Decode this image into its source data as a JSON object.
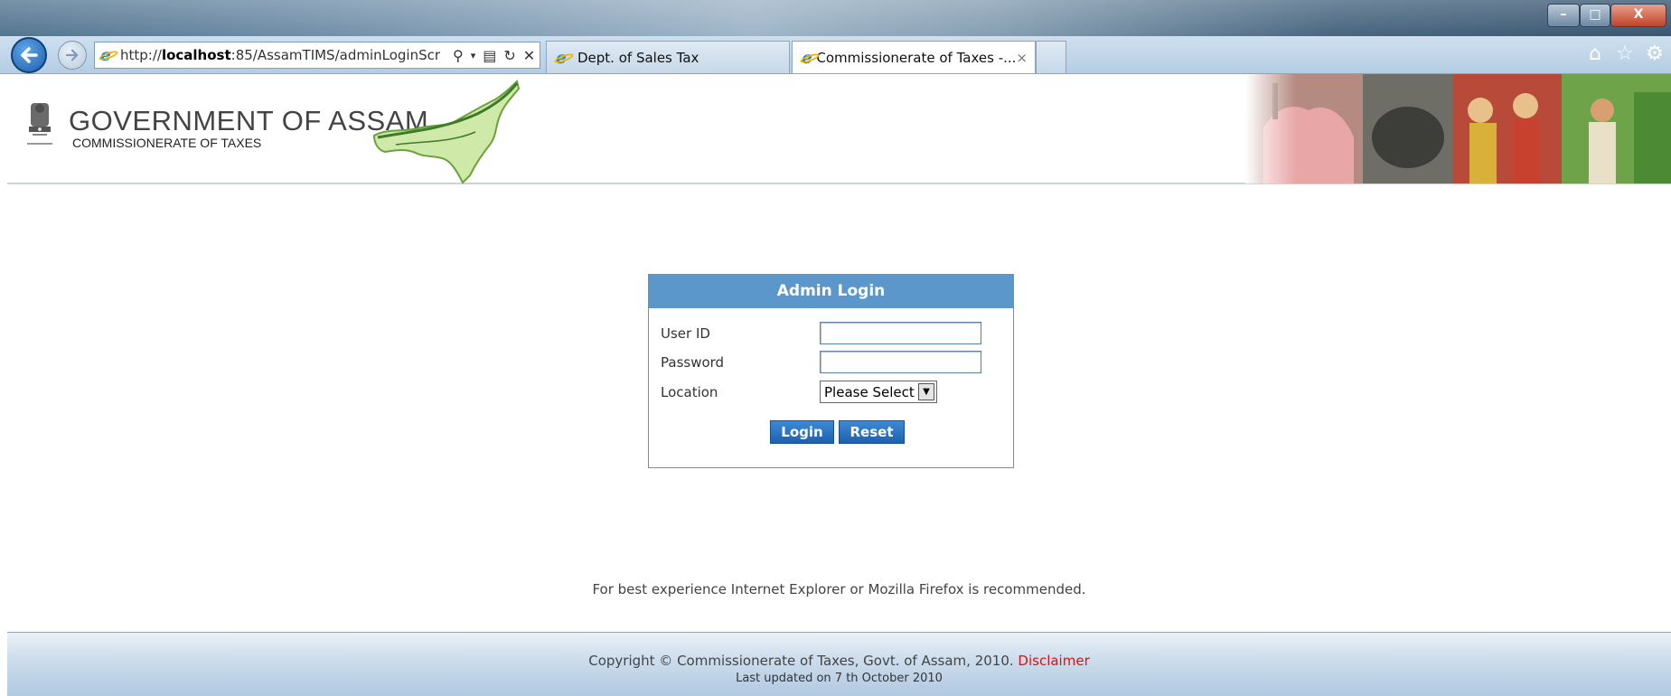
{
  "browser": {
    "address_url_prefix": "http://",
    "address_url_host": "localhost",
    "address_url_rest": ":85/AssamTIMS/adminLoginScr",
    "tabs": [
      {
        "label": "Dept. of Sales Tax"
      },
      {
        "label": "Commissionerate of Taxes -..."
      }
    ],
    "tab_close": "×",
    "icons": [
      "back-icon",
      "forward-icon",
      "ie-logo-icon",
      "search-icon",
      "compat-icon",
      "refresh-icon",
      "stop-icon",
      "home-icon",
      "favorites-icon",
      "gear-icon"
    ],
    "window_controls": {
      "minimize": "–",
      "maximize": "□",
      "close": "X"
    }
  },
  "header": {
    "title": "GOVERNMENT OF ASSAM",
    "subtitle": "COMMISSIONERATE OF TAXES"
  },
  "login": {
    "heading": "Admin Login",
    "user_label": "User ID",
    "password_label": "Password",
    "location_label": "Location",
    "location_value": "Please Select",
    "login_label": "Login",
    "reset_label": "Reset"
  },
  "note": "For best experience Internet Explorer or Mozilla Firefox is recommended.",
  "footer": {
    "copyright": "Copyright © Commissionerate of Taxes, Govt. of Assam, 2010.",
    "disclaimer": "Disclaimer",
    "updated": "Last updated on 7 th October 2010"
  },
  "colors": {
    "login_header": "#5c97cc",
    "button": "#1d61ad",
    "disclaimer": "#e01010"
  }
}
